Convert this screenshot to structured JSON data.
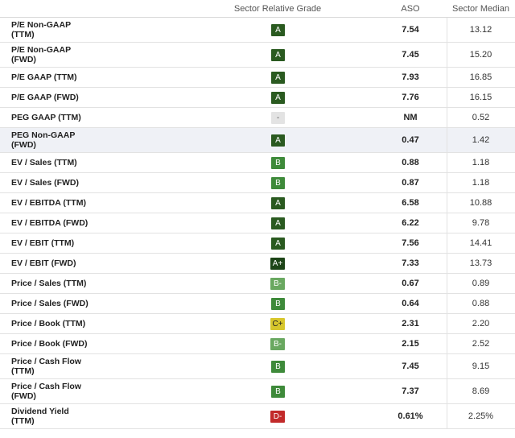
{
  "header": {
    "grade": "Sector Relative Grade",
    "aso": "ASO",
    "median": "Sector Median"
  },
  "grade_colors": {
    "A+": "#1c4417",
    "A": "#2a5a20",
    "B": "#3e8a3a",
    "B-": "#69a860",
    "C+": "#d7c62c",
    "D-": "#c22a2a",
    "-": "#e3e3e3"
  },
  "rows": [
    {
      "metric": "P/E Non-GAAP\n(TTM)",
      "grade": "A",
      "aso": "7.54",
      "median": "13.12",
      "tall": true
    },
    {
      "metric": "P/E Non-GAAP\n(FWD)",
      "grade": "A",
      "aso": "7.45",
      "median": "15.20",
      "tall": true
    },
    {
      "metric": "P/E GAAP (TTM)",
      "grade": "A",
      "aso": "7.93",
      "median": "16.85",
      "tall": false
    },
    {
      "metric": "P/E GAAP (FWD)",
      "grade": "A",
      "aso": "7.76",
      "median": "16.15",
      "tall": false
    },
    {
      "metric": "PEG GAAP (TTM)",
      "grade": "-",
      "aso": "NM",
      "median": "0.52",
      "tall": false
    },
    {
      "metric": "PEG Non-GAAP\n(FWD)",
      "grade": "A",
      "aso": "0.47",
      "median": "1.42",
      "tall": true,
      "highlight": true
    },
    {
      "metric": "EV / Sales (TTM)",
      "grade": "B",
      "aso": "0.88",
      "median": "1.18",
      "tall": false
    },
    {
      "metric": "EV / Sales (FWD)",
      "grade": "B",
      "aso": "0.87",
      "median": "1.18",
      "tall": false
    },
    {
      "metric": "EV / EBITDA (TTM)",
      "grade": "A",
      "aso": "6.58",
      "median": "10.88",
      "tall": false
    },
    {
      "metric": "EV / EBITDA (FWD)",
      "grade": "A",
      "aso": "6.22",
      "median": "9.78",
      "tall": false
    },
    {
      "metric": "EV / EBIT (TTM)",
      "grade": "A",
      "aso": "7.56",
      "median": "14.41",
      "tall": false
    },
    {
      "metric": "EV / EBIT (FWD)",
      "grade": "A+",
      "aso": "7.33",
      "median": "13.73",
      "tall": false
    },
    {
      "metric": "Price / Sales (TTM)",
      "grade": "B-",
      "aso": "0.67",
      "median": "0.89",
      "tall": false
    },
    {
      "metric": "Price / Sales (FWD)",
      "grade": "B",
      "aso": "0.64",
      "median": "0.88",
      "tall": false
    },
    {
      "metric": "Price / Book (TTM)",
      "grade": "C+",
      "aso": "2.31",
      "median": "2.20",
      "tall": false
    },
    {
      "metric": "Price / Book (FWD)",
      "grade": "B-",
      "aso": "2.15",
      "median": "2.52",
      "tall": false
    },
    {
      "metric": "Price / Cash Flow\n(TTM)",
      "grade": "B",
      "aso": "7.45",
      "median": "9.15",
      "tall": true
    },
    {
      "metric": "Price / Cash Flow\n(FWD)",
      "grade": "B",
      "aso": "7.37",
      "median": "8.69",
      "tall": true
    },
    {
      "metric": "Dividend Yield\n(TTM)",
      "grade": "D-",
      "aso": "0.61%",
      "median": "2.25%",
      "tall": true
    }
  ]
}
